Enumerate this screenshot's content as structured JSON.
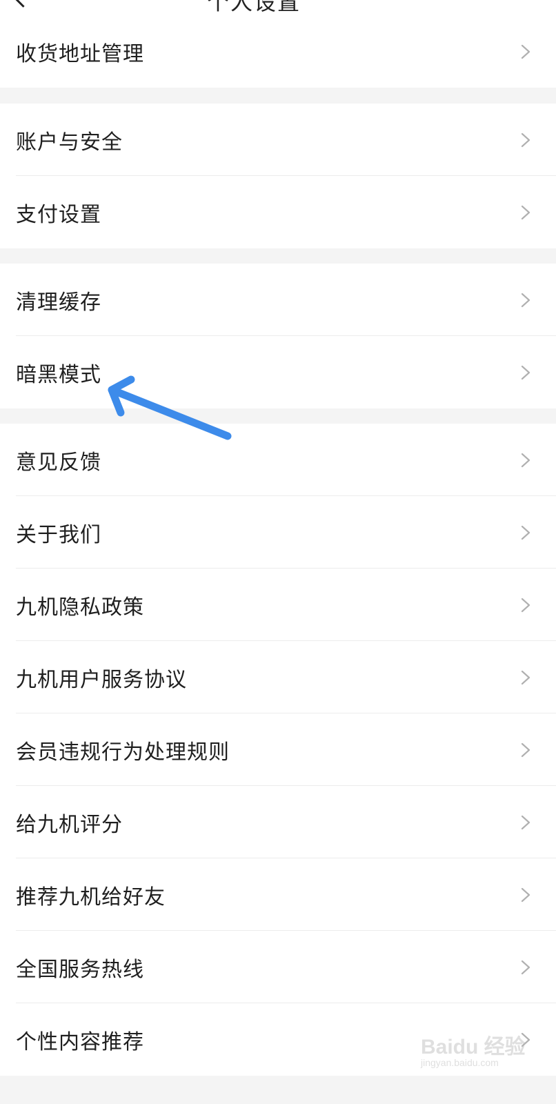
{
  "header": {
    "title_partial": "个人设置"
  },
  "groups": [
    {
      "items": [
        {
          "label": "收货地址管理"
        }
      ]
    },
    {
      "items": [
        {
          "label": "账户与安全"
        },
        {
          "label": "支付设置"
        }
      ]
    },
    {
      "items": [
        {
          "label": "清理缓存"
        },
        {
          "label": "暗黑模式"
        }
      ]
    },
    {
      "items": [
        {
          "label": "意见反馈"
        },
        {
          "label": "关于我们"
        },
        {
          "label": "九机隐私政策"
        },
        {
          "label": "九机用户服务协议"
        },
        {
          "label": "会员违规行为处理规则"
        },
        {
          "label": "给九机评分"
        },
        {
          "label": "推荐九机给好友"
        },
        {
          "label": "全国服务热线"
        },
        {
          "label": "个性内容推荐"
        }
      ]
    }
  ],
  "annotation": {
    "icon": "arrow-icon",
    "color": "#3d8bea",
    "points_to": "暗黑模式"
  },
  "watermark": {
    "brand": "Baidu 经验",
    "url": "jingyan.baidu.com"
  },
  "colors": {
    "background": "#f4f4f4",
    "row_background": "#ffffff",
    "text": "#1f1f1f",
    "chevron": "#b0b0b0",
    "divider": "#ececec"
  }
}
